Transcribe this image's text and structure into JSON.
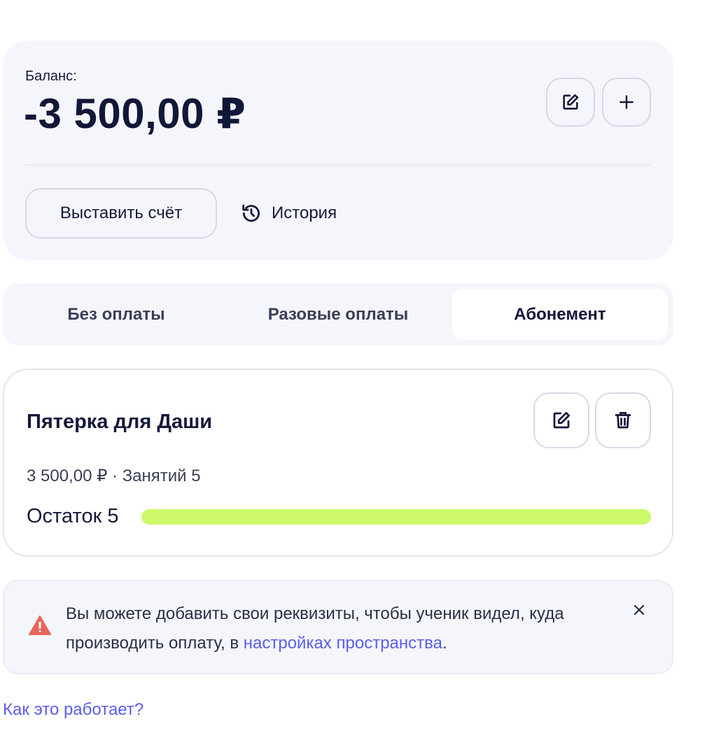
{
  "balance": {
    "label": "Баланс:",
    "amount": "-3 500,00 ₽",
    "edit_icon": "edit-icon",
    "add_icon": "plus-icon",
    "invoice_label": "Выставить счёт",
    "history_label": "История",
    "history_icon": "history-icon"
  },
  "tabs": [
    {
      "label": "Без оплаты",
      "active": false
    },
    {
      "label": "Разовые оплаты",
      "active": false
    },
    {
      "label": "Абонемент",
      "active": true
    }
  ],
  "subscription": {
    "title": "Пятерка для Даши",
    "meta": "3 500,00 ₽ · Занятий 5",
    "remaining_label": "Остаток 5",
    "remaining_fraction": 1.0,
    "progress_color": "#cdf96a",
    "edit_icon": "edit-icon",
    "delete_icon": "trash-icon"
  },
  "notice": {
    "icon": "warning-icon",
    "text_before": "Вы можете добавить свои реквизиты, чтобы ученик видел, куда производить оплату, в ",
    "link_text": "настройках пространства",
    "text_after": ".",
    "close_icon": "close-icon"
  },
  "help_link": "Как это работает?",
  "colors": {
    "accent": "#5b5ef0",
    "warning": "#e8655a",
    "card_bg": "#f5f6fb"
  }
}
